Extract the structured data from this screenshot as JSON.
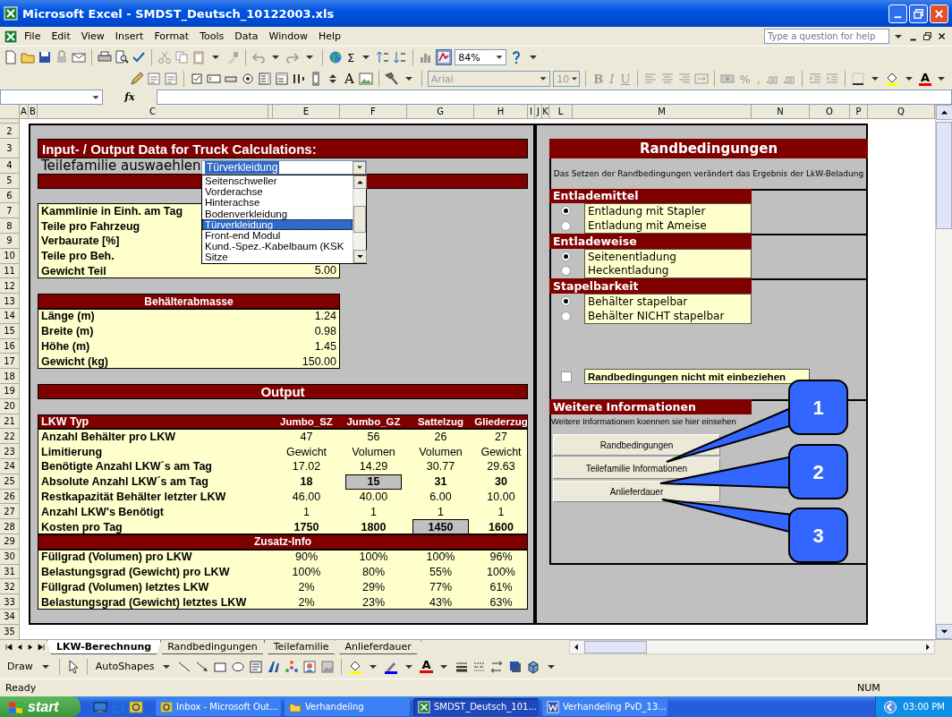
{
  "window": {
    "title": "Microsoft Excel - SMDST_Deutsch_10122003.xls"
  },
  "menu": [
    "File",
    "Edit",
    "View",
    "Insert",
    "Format",
    "Tools",
    "Data",
    "Window",
    "Help"
  ],
  "help_box": {
    "placeholder": "Type a question for help"
  },
  "standard_toolbar": {
    "autosum": "Σ",
    "zoom": "84%"
  },
  "formatting_toolbar": {
    "disabled": true,
    "label_tool": "A",
    "font": "Arial",
    "size": "10",
    "style_buttons": [
      "B",
      "I",
      "U"
    ],
    "number_buttons": [
      "%",
      ","
    ],
    "font_color": "A"
  },
  "formula_bar": {
    "function_label": "fx"
  },
  "columns": [
    "A",
    "B",
    "C",
    "E",
    "F",
    "G",
    "H",
    "I",
    "J",
    "K",
    "L",
    "M",
    "N",
    "O",
    "P",
    "Q"
  ],
  "row_numbers": [
    "2",
    "3",
    "4",
    "5",
    "6",
    "7",
    "8",
    "9",
    "10",
    "11",
    "12",
    "13",
    "14",
    "15",
    "16",
    "17",
    "18",
    "19",
    "20",
    "21",
    "22",
    "23",
    "24",
    "25",
    "26",
    "27",
    "28",
    "29",
    "30",
    "31",
    "32",
    "33",
    "34",
    "35"
  ],
  "input_panel": {
    "title": "Input- / Output Data for Truck Calculations:",
    "selector": {
      "label": "Teilefamilie auswaehlen",
      "value": "Türverkleidung",
      "expanded": true,
      "options": [
        {
          "label": "Seitenschweller",
          "selected": false
        },
        {
          "label": "Vorderachse",
          "selected": false
        },
        {
          "label": "Hinterachse",
          "selected": false
        },
        {
          "label": "Bodenverkleidung",
          "selected": false
        },
        {
          "label": "Türverkleidung",
          "selected": true
        },
        {
          "label": "Front-end Modul",
          "selected": false
        },
        {
          "label": "Kund.-Spez.-Kabelbaum (KSK",
          "selected": false
        },
        {
          "label": "Sitze",
          "selected": false
        }
      ]
    },
    "inputs": [
      {
        "label": "Kammlinie in Einh. am Tag"
      },
      {
        "label": "Teile pro Fahrzeug"
      },
      {
        "label": "Verbaurate [%]"
      },
      {
        "label": "Teile pro Beh."
      },
      {
        "label": "Gewicht Teil",
        "value": "5.00"
      }
    ],
    "container": {
      "title": "Behälterabmasse",
      "rows": [
        {
          "label": "Länge (m)",
          "value": "1.24"
        },
        {
          "label": "Breite (m)",
          "value": "0.98"
        },
        {
          "label": "Höhe (m)",
          "value": "1.45"
        },
        {
          "label": "Gewicht (kg)",
          "value": "150.00"
        }
      ]
    }
  },
  "output": {
    "title": "Output",
    "header": {
      "label": "LKW Typ",
      "columns": [
        "Jumbo_SZ",
        "Jumbo_GZ",
        "Sattelzug",
        "Gliederzug"
      ]
    },
    "rows": [
      {
        "label": "Anzahl Behälter pro LKW",
        "bold": false,
        "cells": [
          {
            "value": "47",
            "highlighted": false
          },
          {
            "value": "56",
            "highlighted": false
          },
          {
            "value": "26",
            "highlighted": false
          },
          {
            "value": "27",
            "highlighted": false
          }
        ]
      },
      {
        "label": "Limitierung",
        "bold": false,
        "cells": [
          {
            "value": "Gewicht",
            "highlighted": false
          },
          {
            "value": "Volumen",
            "highlighted": false
          },
          {
            "value": "Volumen",
            "highlighted": false
          },
          {
            "value": "Gewicht",
            "highlighted": false
          }
        ]
      },
      {
        "label": "Benötigte Anzahl LKW´s am Tag",
        "bold": false,
        "cells": [
          {
            "value": "17.02",
            "highlighted": false
          },
          {
            "value": "14.29",
            "highlighted": false
          },
          {
            "value": "30.77",
            "highlighted": false
          },
          {
            "value": "29.63",
            "highlighted": false
          }
        ]
      },
      {
        "label": "Absolute Anzahl LKW´s am Tag",
        "bold": true,
        "cells": [
          {
            "value": "18",
            "highlighted": false
          },
          {
            "value": "15",
            "highlighted": true
          },
          {
            "value": "31",
            "highlighted": false
          },
          {
            "value": "30",
            "highlighted": false
          }
        ]
      },
      {
        "label": "Restkapazität Behälter letzter LKW",
        "bold": false,
        "cells": [
          {
            "value": "46.00",
            "highlighted": false
          },
          {
            "value": "40.00",
            "highlighted": false
          },
          {
            "value": "6.00",
            "highlighted": false
          },
          {
            "value": "10.00",
            "highlighted": false
          }
        ]
      },
      {
        "label": "Anzahl LKW's Benötigt",
        "bold": false,
        "cells": [
          {
            "value": "1",
            "highlighted": false
          },
          {
            "value": "1",
            "highlighted": false
          },
          {
            "value": "1",
            "highlighted": false
          },
          {
            "value": "1",
            "highlighted": false
          }
        ]
      },
      {
        "label": "Kosten pro Tag",
        "bold": true,
        "cells": [
          {
            "value": "1750",
            "highlighted": false
          },
          {
            "value": "1800",
            "highlighted": false
          },
          {
            "value": "1450",
            "highlighted": true
          },
          {
            "value": "1600",
            "highlighted": false
          }
        ]
      }
    ],
    "extra_title": "Zusatz-Info",
    "extra_rows": [
      {
        "label": "Füllgrad (Volumen) pro LKW",
        "cells": [
          "90%",
          "100%",
          "100%",
          "96%"
        ]
      },
      {
        "label": "Belastungsgrad (Gewicht) pro LKW",
        "cells": [
          "100%",
          "80%",
          "55%",
          "100%"
        ]
      },
      {
        "label": "Füllgrad (Volumen) letztes LKW",
        "cells": [
          "2%",
          "29%",
          "77%",
          "61%"
        ]
      },
      {
        "label": "Belastungsgrad (Gewicht) letztes LKW",
        "cells": [
          "2%",
          "23%",
          "43%",
          "63%"
        ]
      }
    ]
  },
  "conditions": {
    "title": "Randbedingungen",
    "note": "Das Setzen der Randbedingungen verändert das Ergebnis der LkW-Beladung",
    "groups": [
      {
        "title": "Entlademittel",
        "options": [
          {
            "label": "Entladung mit Stapler",
            "selected": true
          },
          {
            "label": "Entladung mit Ameise",
            "selected": false
          }
        ]
      },
      {
        "title": "Entladeweise",
        "options": [
          {
            "label": "Seitenentladung",
            "selected": true
          },
          {
            "label": "Heckentladung",
            "selected": false
          }
        ]
      },
      {
        "title": "Stapelbarkeit",
        "options": [
          {
            "label": "Behälter stapelbar",
            "selected": true
          },
          {
            "label": "Behälter NICHT stapelbar",
            "selected": false
          }
        ]
      }
    ],
    "ignore": {
      "label": "Randbedingungen nicht mit einbeziehen",
      "checked": false
    },
    "info": {
      "title": "Weitere Informationen",
      "text": "Weitere Informationen koennen sie hier einsehen",
      "buttons": [
        "Randbedingungen",
        "Teilefamilie Informationen",
        "Anlieferdauer"
      ]
    }
  },
  "callouts": [
    "1",
    "2",
    "3"
  ],
  "sheet_tabs": [
    {
      "label": "LKW-Berechnung",
      "selected": true
    },
    {
      "label": "Randbedingungen",
      "selected": false
    },
    {
      "label": "Teilefamilie",
      "selected": false
    },
    {
      "label": "Anlieferdauer",
      "selected": false
    }
  ],
  "draw_toolbar": {
    "draw": "Draw",
    "autoshapes": "AutoShapes",
    "font_color": "A"
  },
  "status_bar": {
    "text": "Ready",
    "indicator": "NUM"
  },
  "taskbar": {
    "start": "start",
    "tasks": [
      {
        "label": "Inbox - Microsoft Out...",
        "selected": false
      },
      {
        "label": "Verhandeling",
        "selected": false
      },
      {
        "label": "SMDST_Deutsch_101...",
        "selected": true
      },
      {
        "label": "Verhandeling PvD_13...",
        "selected": false
      }
    ],
    "clock": "03:00 PM"
  }
}
